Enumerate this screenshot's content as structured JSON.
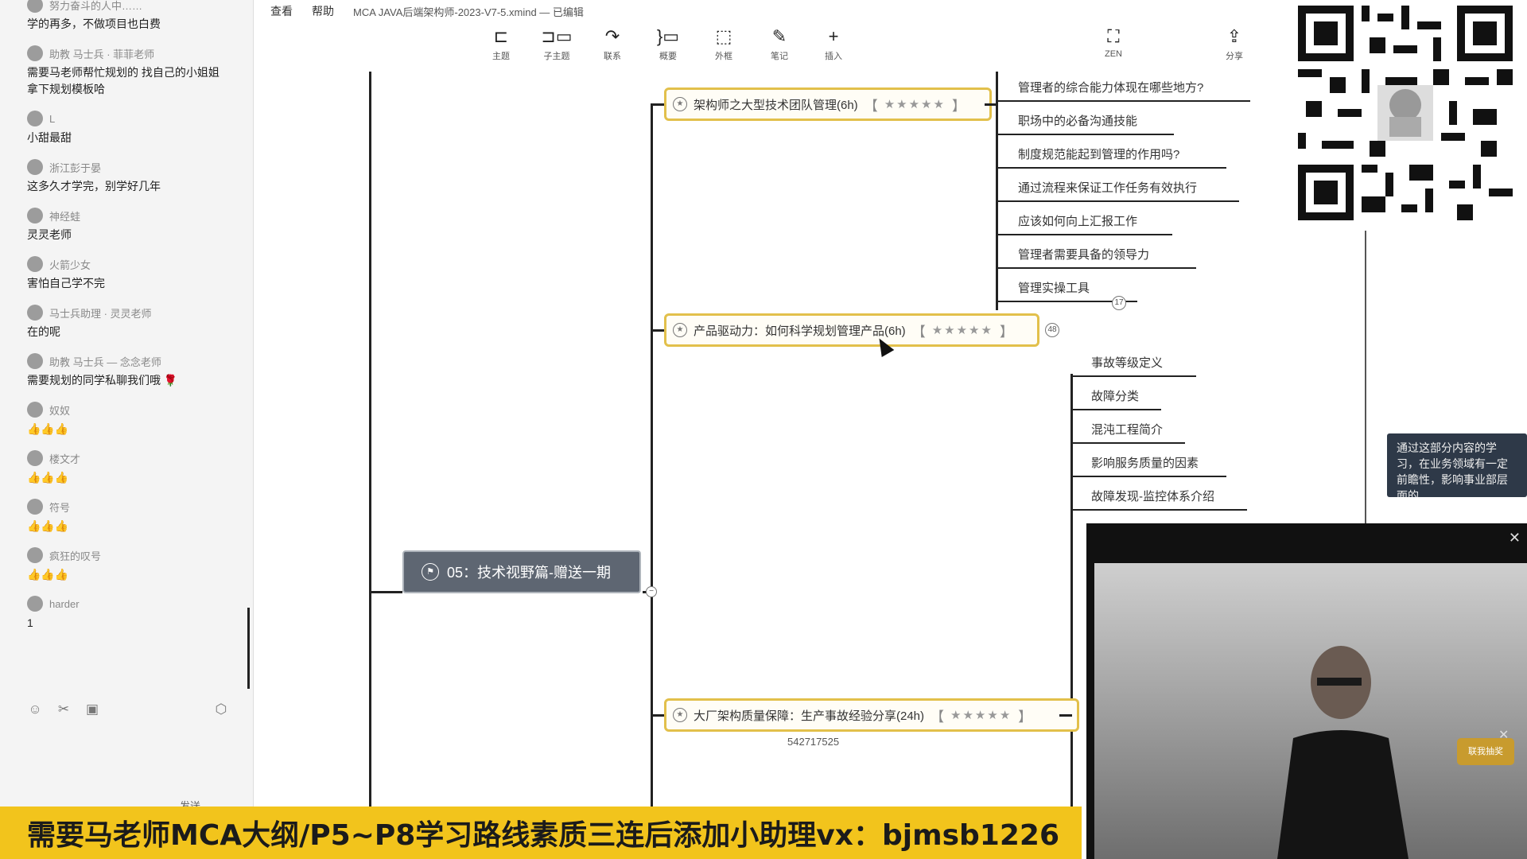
{
  "chat": {
    "messages": [
      {
        "user": "努力奋斗的人中……",
        "text": "学的再多，不做项目也白费"
      },
      {
        "user": "助教  马士兵 · 菲菲老师",
        "text": "需要马老师帮忙规划的 找自己的小姐姐\n拿下规划模板哈"
      },
      {
        "user": "L",
        "text": "小甜最甜"
      },
      {
        "user": "浙江彭于晏",
        "text": "这多久才学完，别学好几年"
      },
      {
        "user": "神经蛙",
        "text": "灵灵老师"
      },
      {
        "user": "火箭少女",
        "text": "害怕自己学不完"
      },
      {
        "user": "马士兵助理 · 灵灵老师",
        "text": "在的呢"
      },
      {
        "user": "助教  马士兵 — 念念老师",
        "text": "需要规划的同学私聊我们哦 🌹"
      },
      {
        "user": "奴奴",
        "text": "👍👍👍"
      },
      {
        "user": "楼文才",
        "text": "👍👍👍"
      },
      {
        "user": "符号",
        "text": "👍👍👍"
      },
      {
        "user": "疯狂的叹号",
        "text": "👍👍👍"
      },
      {
        "user": "harder",
        "text": "1"
      }
    ],
    "send_label": "发送"
  },
  "menubar": {
    "items": [
      "查看",
      "帮助"
    ],
    "filename": "MCA JAVA后端架构师-2023-V7-5.xmind — 已编辑"
  },
  "toolbar": {
    "topic": "主题",
    "subtopic": "子主题",
    "relation": "联系",
    "summary": "概要",
    "boundary": "外框",
    "note": "笔记",
    "insert": "插入",
    "zen": "ZEN",
    "share": "分享"
  },
  "map": {
    "node1": {
      "title": "架构师之大型技术团队管理(6h)",
      "rating": "★★★★★"
    },
    "node1_children": [
      "管理者的综合能力体现在哪些地方?",
      "职场中的必备沟通技能",
      "制度规范能起到管理的作用吗?",
      "通过流程来保证工作任务有效执行",
      "应该如何向上汇报工作",
      "管理者需要具备的领导力",
      "管理实操工具"
    ],
    "node1_count": "17",
    "node2": {
      "title": "产品驱动力：如何科学规划管理产品(6h)",
      "rating": "★★★★★"
    },
    "node2_count": "48",
    "node3_children": [
      "事故等级定义",
      "故障分类",
      "混沌工程简介",
      "影响服务质量的因素",
      "故障发现-监控体系介绍"
    ],
    "node3": {
      "title": "大厂架构质量保障：生产事故经验分享(24h)",
      "rating": "★★★★★"
    },
    "topic05": "05：技术视野篇-赠送一期",
    "id_label": "542717525"
  },
  "tooltip": "通过这部分内容的学习，在业务领域有一定前瞻性，影响事业部层面的",
  "video": {
    "badge": "联我抽奖"
  },
  "banner": "需要马老师MCA大纲/P5~P8学习路线素质三连后添加小助理vx：bjmsb1226"
}
